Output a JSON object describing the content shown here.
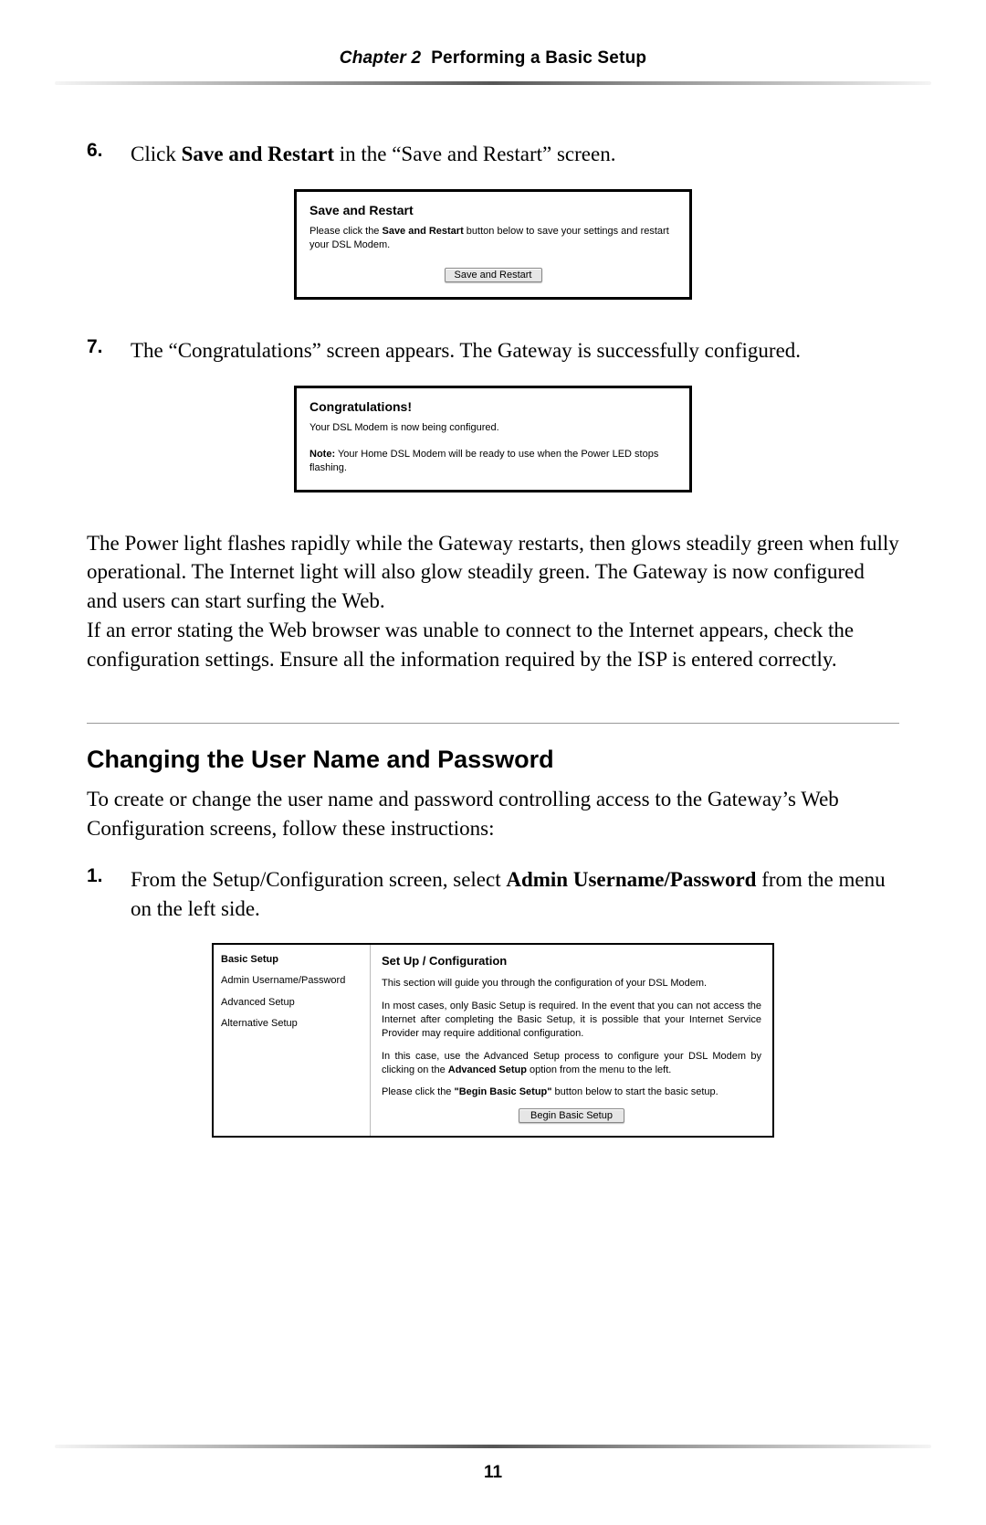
{
  "header": {
    "chapter": "Chapter 2",
    "title": "Performing a Basic Setup"
  },
  "steps": {
    "six_num": "6.",
    "six_body_pre": "Click ",
    "six_body_b": "Save and Restart",
    "six_body_post": " in the “Save and Restart” screen.",
    "seven_num": "7.",
    "seven_body": "The “Congratulations” screen appears. The Gateway is successfully configured."
  },
  "save_box": {
    "title": "Save and Restart",
    "text_pre": "Please click the ",
    "text_b": "Save and Restart",
    "text_post": " button below to save your settings and restart your DSL Modem.",
    "button": "Save and Restart"
  },
  "congrats_box": {
    "title": "Congratulations!",
    "line1": "Your DSL Modem is now being configured.",
    "note_b": "Note:",
    "note_post": " Your Home DSL Modem will be ready to use when the Power LED stops flashing."
  },
  "paragraphs": {
    "p1": "The Power light flashes rapidly while the Gateway restarts, then glows steadily green when fully operational. The Internet light will also glow steadily green. The Gateway is now configured and users can start surfing the Web.",
    "p2_a": "If an error stating the Web browser was unable to connect to the Internet appears, check the configuration settings. Ensure all the information required by the ",
    "p2_isp": "ISP",
    "p2_b": " is entered correctly."
  },
  "section_heading": "Changing the User Name and Password",
  "section_intro": "To create or change the user name and password controlling access to the Gateway’s Web Configuration screens, follow these instructions:",
  "step1": {
    "num": "1.",
    "pre": "From the Setup/Configuration screen, select ",
    "b": "Admin Username/Password",
    "post": " from the menu on the left side."
  },
  "cfgbox": {
    "menu": {
      "basic": "Basic Setup",
      "admin": "Admin Username/Password",
      "advanced": "Advanced Setup",
      "alternative": "Alternative Setup"
    },
    "title": "Set Up / Configuration",
    "p1": "This section will guide you through the configuration of your DSL Modem.",
    "p2": "In most cases, only Basic Setup is required. In the event that you can not access the Internet after completing the Basic Setup, it is possible that your Internet Service Provider may require additional configuration.",
    "p3_pre": "In this case, use the Advanced Setup process to configure your DSL Modem by clicking on the ",
    "p3_b": "Advanced Setup",
    "p3_post": " option from the menu to the left.",
    "p4_pre": "Please click the ",
    "p4_b": "\"Begin Basic Setup\"",
    "p4_post": " button below to start the basic setup.",
    "button": "Begin Basic Setup"
  },
  "page_number": "11"
}
